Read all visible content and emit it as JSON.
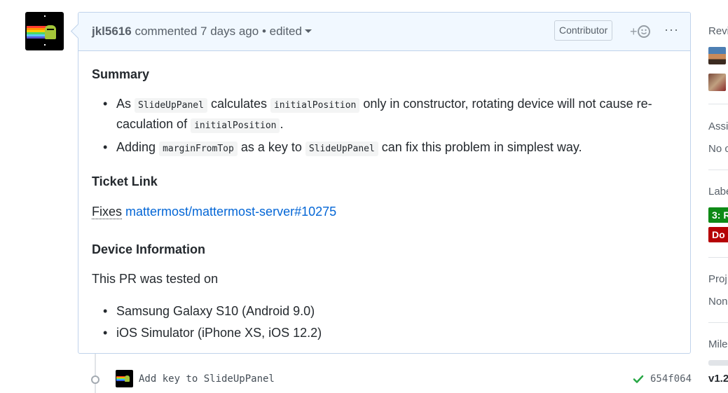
{
  "comment": {
    "author": "jkl5616",
    "action": "commented",
    "time": "7 days ago",
    "separator": "•",
    "edited": "edited",
    "badge": "Contributor",
    "reaction_plus": "+",
    "more": "···"
  },
  "body": {
    "summary_heading": "Summary",
    "bullet1": {
      "t1": "As ",
      "c1": "SlideUpPanel",
      "t2": " calculates ",
      "c2": "initialPosition",
      "t3": " only in constructor, rotating device will not cause re-",
      "t4": "caculation of ",
      "c3": "initialPosition",
      "t5": "."
    },
    "bullet2": {
      "t1": "Adding ",
      "c1": "marginFromTop",
      "t2": " as a key to ",
      "c2": "SlideUpPanel",
      "t3": " can fix this problem in simplest way."
    },
    "ticket_heading": "Ticket Link",
    "fixes_word": "Fixes",
    "fixes_link": "mattermost/mattermost-server#10275",
    "device_heading": "Device Information",
    "tested_on": "This PR was tested on",
    "devices": [
      "Samsung Galaxy S10 (Android 9.0)",
      "iOS Simulator (iPhone XS, iOS 12.2)"
    ]
  },
  "commit": {
    "message": "Add key to SlideUpPanel",
    "sha": "654f064",
    "status_color": "#28a745"
  },
  "sidebar": {
    "reviewers_heading": "Revi",
    "assignees_heading": "Assi",
    "assignees_value": "No c",
    "labels_heading": "Labe",
    "labels": [
      {
        "text": "3: R",
        "color": "#0e8a16"
      },
      {
        "text": "Do",
        "color": "#b60205"
      }
    ],
    "projects_heading": "Proj",
    "projects_value": "Non",
    "milestone_heading": "Mile",
    "milestone_value": "v1.2"
  }
}
